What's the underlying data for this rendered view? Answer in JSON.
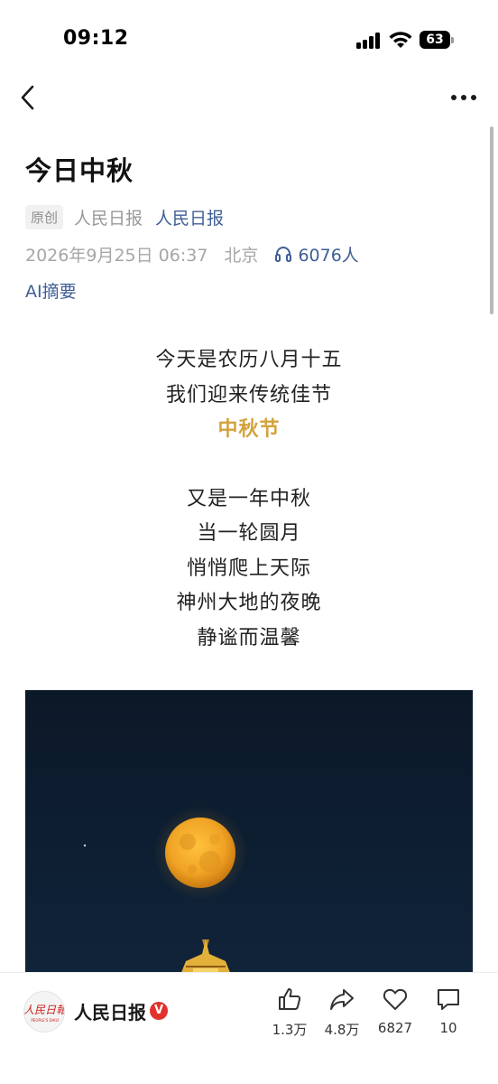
{
  "status_bar": {
    "time": "09:12",
    "battery": "63"
  },
  "article": {
    "title": "今日中秋",
    "tag": "原创",
    "source": "人民日报",
    "author": "人民日报",
    "date": "2026年9月25日 06:37",
    "location": "北京",
    "listeners": "6076人",
    "ai_summary": "AI摘要"
  },
  "poem": {
    "lines_a": [
      "今天是农历八月十五",
      "我们迎来传统佳节"
    ],
    "highlight": "中秋节",
    "lines_b": [
      "又是一年中秋",
      "当一轮圆月",
      "悄悄爬上天际",
      "神州大地的夜晚",
      "静谧而温馨"
    ]
  },
  "colors": {
    "link": "#3f5f95",
    "highlight": "#d4a23c",
    "image_sky": "#0c1a2b",
    "moon": "#f0a324"
  },
  "bottom_bar": {
    "author_name": "人民日报",
    "verified_badge": "V",
    "avatar_logo_text": "人民日報",
    "avatar_logo_subtext": "PEOPLE'S DAILY",
    "likes": "1.3万",
    "shares": "4.8万",
    "favorites": "6827",
    "comments": "10"
  },
  "icons": [
    "back-chevron-icon",
    "more-dots-icon",
    "headphones-icon",
    "thumbs-up-icon",
    "share-arrow-icon",
    "heart-icon",
    "comment-icon"
  ]
}
